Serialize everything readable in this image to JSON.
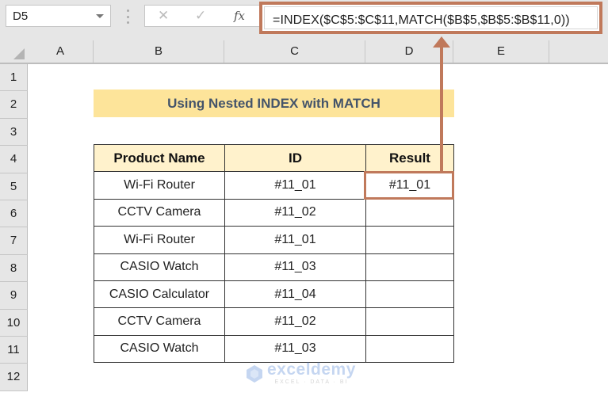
{
  "formula_bar": {
    "name_box": "D5",
    "cancel_icon": "✕",
    "enter_icon": "✓",
    "fx_label": "fx",
    "formula": "=INDEX($C$5:$C$11,MATCH($B$5,$B$5:$B$11,0))"
  },
  "columns": [
    "A",
    "B",
    "C",
    "D",
    "E"
  ],
  "rows": [
    "1",
    "2",
    "3",
    "4",
    "5",
    "6",
    "7",
    "8",
    "9",
    "10",
    "11",
    "12"
  ],
  "sheet": {
    "title": "Using Nested INDEX with MATCH",
    "headers": [
      "Product Name",
      "ID",
      "Result"
    ],
    "data": [
      [
        "Wi-Fi Router",
        "#11_01",
        "#11_01"
      ],
      [
        "CCTV Camera",
        "#11_02",
        ""
      ],
      [
        "Wi-Fi Router",
        "#11_01",
        ""
      ],
      [
        "CASIO Watch",
        "#11_03",
        ""
      ],
      [
        "CASIO Calculator",
        "#11_04",
        ""
      ],
      [
        "CCTV Camera",
        "#11_02",
        ""
      ],
      [
        "CASIO Watch",
        "#11_03",
        ""
      ]
    ]
  },
  "highlight_color": "#c0795b",
  "watermark": {
    "name": "exceldemy",
    "tagline": "EXCEL · DATA · BI"
  }
}
